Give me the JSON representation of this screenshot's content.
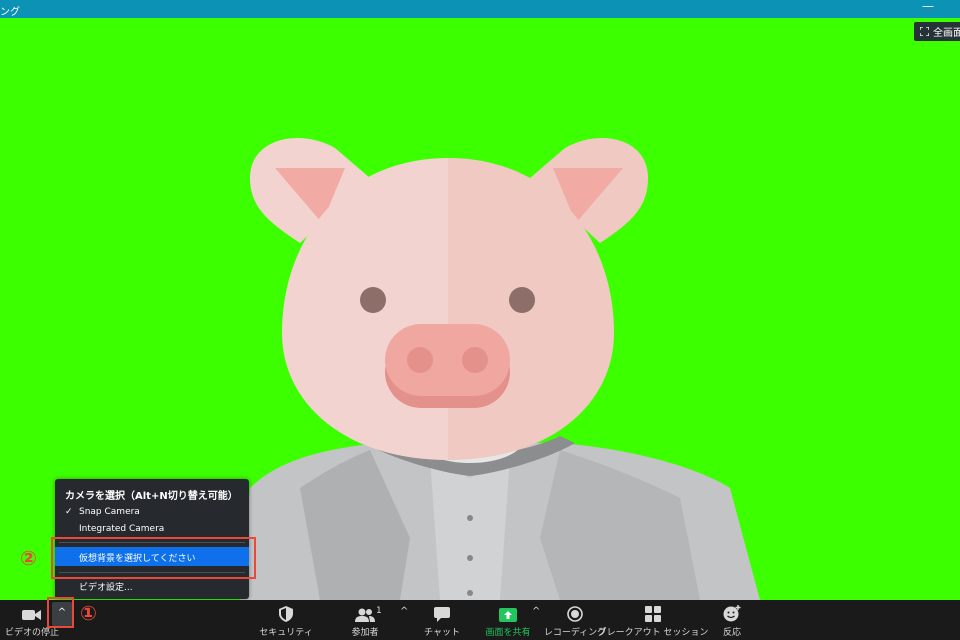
{
  "window": {
    "title": "ング",
    "minimize_glyph": "—"
  },
  "video": {
    "fullscreen_label": "全画面"
  },
  "camera_menu": {
    "header": "カメラを選択（Alt+N切り替え可能）",
    "items": [
      {
        "label": "Snap Camera",
        "checked": true
      },
      {
        "label": "Integrated Camera",
        "checked": false
      },
      {
        "label": "仮想背景を選択してください",
        "checked": false
      },
      {
        "label": "ビデオ設定...",
        "checked": false
      }
    ],
    "check_glyph": "✓"
  },
  "annotations": {
    "one": "①",
    "two": "②"
  },
  "toolbar": {
    "video_stop": "ビデオの停止",
    "caret": "^",
    "security": "セキュリティ",
    "participants": "参加者",
    "participants_count": "1",
    "chat": "チャット",
    "share_screen": "画面を共有",
    "recording": "レコーディング",
    "breakout": "ブレークアウト セッション",
    "reactions": "反応"
  },
  "colors": {
    "green_screen": "#3cff00",
    "title_bar": "#0b92b5",
    "toolbar": "#1a1a1a",
    "menu_highlight": "#0e71eb",
    "annotation": "#e8493a",
    "share_green": "#22c55e"
  }
}
